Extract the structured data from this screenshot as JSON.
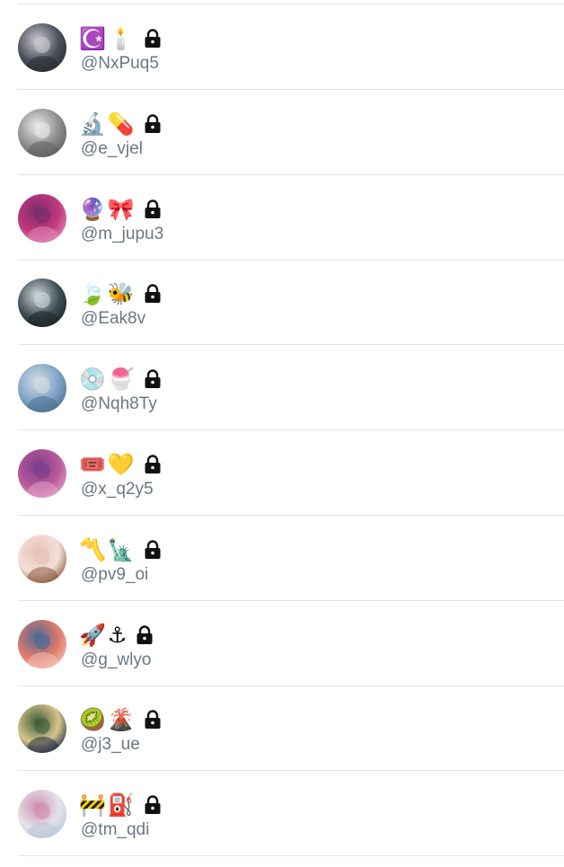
{
  "rows": [
    {
      "emoji": "☪️🕯️",
      "handle": "@NxPuq5",
      "avatar_colors": [
        "#4a4f5c",
        "#c9c9d1",
        "#2a2b30"
      ]
    },
    {
      "emoji": "🔬💊",
      "handle": "@e_vjel",
      "avatar_colors": [
        "#8d8d8d",
        "#e9e9e9",
        "#5e5e5e"
      ]
    },
    {
      "emoji": "🔮🎀",
      "handle": "@m_jupu3",
      "avatar_colors": [
        "#c2387c",
        "#7b2d6b",
        "#e08ab8"
      ]
    },
    {
      "emoji": "🍃🐝",
      "handle": "@Eak8v",
      "avatar_colors": [
        "#3e4f56",
        "#cfd6d9",
        "#1c2226"
      ]
    },
    {
      "emoji": "💿🍧",
      "handle": "@Nqh8Ty",
      "avatar_colors": [
        "#7fa3c6",
        "#d4dce3",
        "#4e6f8f"
      ]
    },
    {
      "emoji": "🎟️💛",
      "handle": "@x_q2y5",
      "avatar_colors": [
        "#b85a9a",
        "#7d3d8e",
        "#e2a0c6"
      ]
    },
    {
      "emoji": "〽️🗽",
      "handle": "@pv9_oi",
      "avatar_colors": [
        "#f3dfd8",
        "#e8c2b8",
        "#8a5a3c"
      ]
    },
    {
      "emoji": "🚀⚓",
      "handle": "@g_wlyo",
      "avatar_colors": [
        "#e07a6a",
        "#4a6a95",
        "#f1c0b4"
      ]
    },
    {
      "emoji": "🥝🌋",
      "handle": "@j3_ue",
      "avatar_colors": [
        "#d8c48c",
        "#3f5e3a",
        "#1f2a44"
      ]
    },
    {
      "emoji": "🚧⛽",
      "handle": "@tm_qdi",
      "avatar_colors": [
        "#e3e3ea",
        "#d28cb0",
        "#b9c6d6"
      ]
    }
  ],
  "colors": {
    "handle": "#6a7784",
    "divider": "#e1e3e8",
    "lock": "#111111"
  },
  "icons": {
    "lock": "lock-icon"
  }
}
